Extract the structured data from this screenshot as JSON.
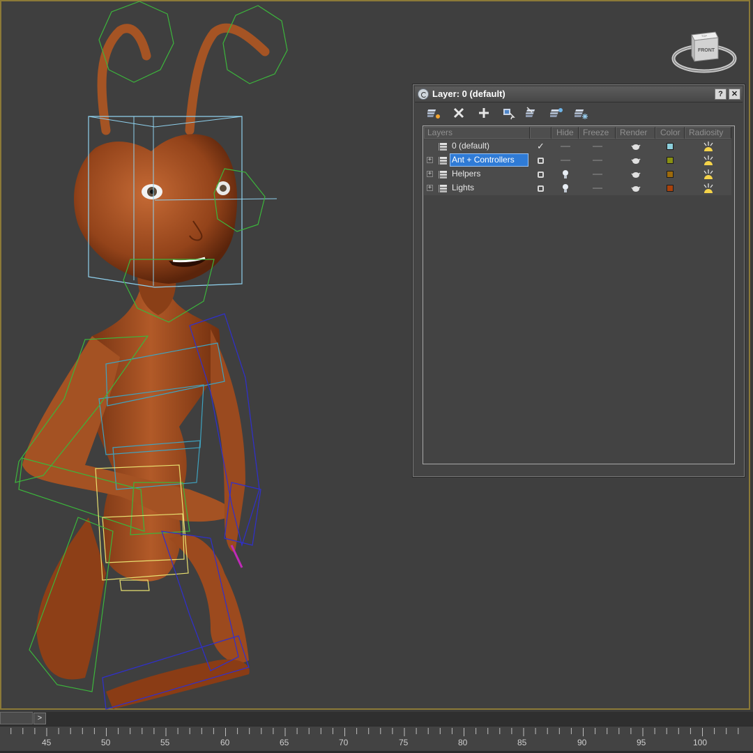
{
  "dialog": {
    "title": "Layer: 0 (default)",
    "help_button": "?",
    "close_button": "✕"
  },
  "toolbar": {
    "tools": [
      {
        "icon": "create-new-layer-icon"
      },
      {
        "icon": "delete-layer-icon"
      },
      {
        "icon": "add-to-layer-icon"
      },
      {
        "icon": "select-objects-in-layer-icon"
      },
      {
        "icon": "highlight-selected-layer-icon"
      },
      {
        "icon": "hide-unhide-all-layers-icon"
      },
      {
        "icon": "freeze-unfreeze-all-layers-icon"
      }
    ]
  },
  "columns": [
    "Layers",
    "",
    "Hide",
    "Freeze",
    "Render",
    "Color",
    "Radiosity"
  ],
  "layers": [
    {
      "name": "0 (default)",
      "current": true,
      "expandable": false,
      "hide": "dash",
      "freeze": "dash",
      "render": "teapot",
      "color": "#8ccfdc",
      "selected": false
    },
    {
      "name": "Ant + Controllers",
      "current": false,
      "expandable": true,
      "hide": "dash",
      "freeze": "dash",
      "render": "teapot",
      "color": "#8a9112",
      "selected": true
    },
    {
      "name": "Helpers",
      "current": false,
      "expandable": true,
      "hide": "bulb",
      "freeze": "dash",
      "render": "teapot",
      "color": "#9d6a0c",
      "selected": false
    },
    {
      "name": "Lights",
      "current": false,
      "expandable": true,
      "hide": "bulb",
      "freeze": "dash",
      "render": "teapot",
      "color": "#a8420c",
      "selected": false
    }
  ],
  "viewcube": {
    "label": "FRONT",
    "top_label": "TOP"
  },
  "timeline": {
    "next_frame_label": ">",
    "ticks": [
      "45",
      "50",
      "55",
      "60",
      "65",
      "70",
      "75",
      "80",
      "85",
      "90",
      "95",
      "100"
    ]
  },
  "colors": {
    "viewport_border": "#8c7a37",
    "selection": "#2f7bd6",
    "ant_body": "#a04e1f"
  }
}
